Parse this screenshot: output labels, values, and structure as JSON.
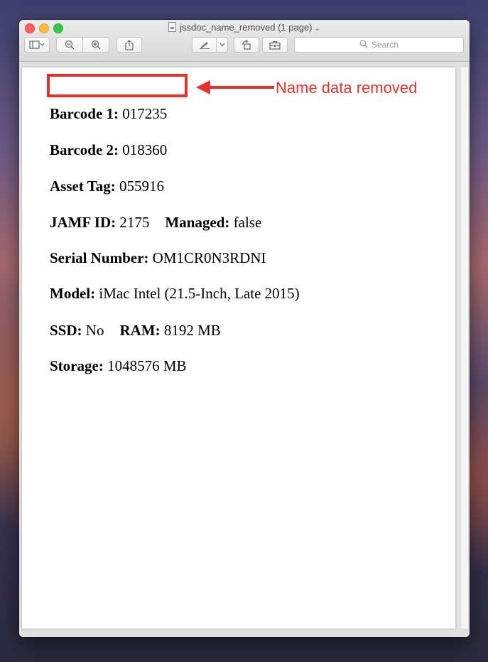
{
  "window": {
    "title": "jssdoc_name_removed (1 page)",
    "search_placeholder": "Search"
  },
  "annotation": {
    "label": "Name data removed",
    "color": "#e8302a"
  },
  "document": {
    "barcode1_label": "Barcode 1:",
    "barcode1_value": "017235",
    "barcode2_label": "Barcode 2:",
    "barcode2_value": "018360",
    "asset_tag_label": "Asset Tag:",
    "asset_tag_value": "055916",
    "jamf_id_label": "JAMF ID:",
    "jamf_id_value": "2175",
    "managed_label": "Managed:",
    "managed_value": "false",
    "serial_label": "Serial Number:",
    "serial_value": "OM1CR0N3RDNI",
    "model_label": "Model:",
    "model_value": "iMac Intel (21.5-Inch, Late 2015)",
    "ssd_label": "SSD:",
    "ssd_value": "No",
    "ram_label": "RAM:",
    "ram_value": "8192 MB",
    "storage_label": "Storage:",
    "storage_value": "1048576 MB"
  }
}
